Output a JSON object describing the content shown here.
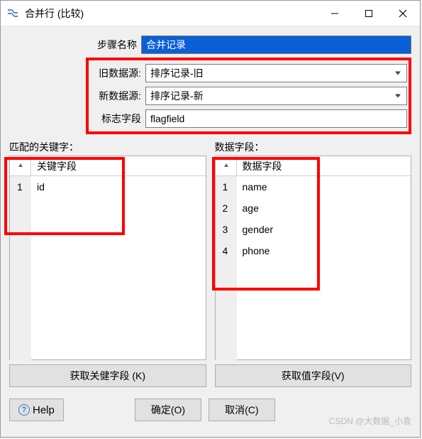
{
  "window": {
    "title": "合并行 (比较)"
  },
  "form": {
    "step_name_label": "步骤名称",
    "step_name_value": "合并记录",
    "old_source_label": "旧数据源:",
    "old_source_value": "排序记录-旧",
    "new_source_label": "新数据源:",
    "new_source_value": "排序记录-新",
    "flag_field_label": "标志字段",
    "flag_field_value": "flagfield"
  },
  "key_panel": {
    "title": "匹配的关键字：",
    "col_num": "#",
    "col_field": "关键字段",
    "rows": [
      {
        "n": "1",
        "v": "id"
      }
    ],
    "button": "获取关健字段 (K)"
  },
  "data_panel": {
    "title": "数据字段：",
    "col_num": "#",
    "col_field": "数据字段",
    "rows": [
      {
        "n": "1",
        "v": "name"
      },
      {
        "n": "2",
        "v": "age"
      },
      {
        "n": "3",
        "v": "gender"
      },
      {
        "n": "4",
        "v": "phone"
      }
    ],
    "button": "获取值字段(V)"
  },
  "footer": {
    "help": "Help",
    "ok": "确定(O)",
    "cancel": "取消(C)"
  },
  "watermark": "CSDN @大数据_小袁"
}
